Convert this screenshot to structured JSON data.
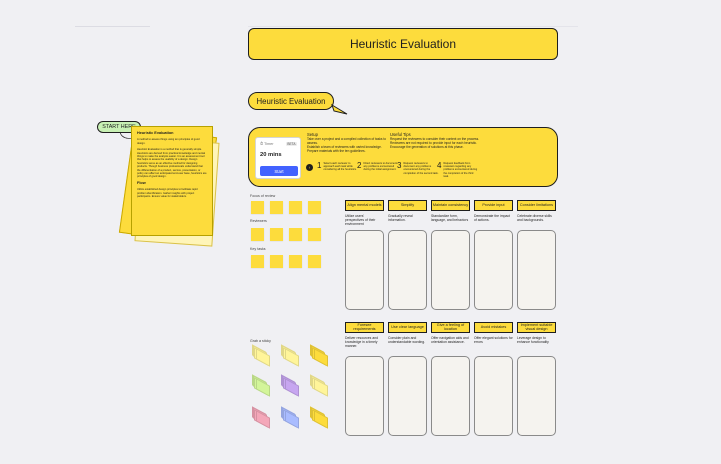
{
  "board": {
    "title": "Heuristic Evaluation",
    "bubble_title": "Heuristic Evaluation",
    "start_here": "START HERE"
  },
  "intro_note": {
    "heading": "Heuristic Evaluation",
    "p1": "A method to assess things using ten principles of good design.",
    "p2": "Heuristic Evaluation is a method that is generally simple. Heuristics are derived from practical knowledge and mental things to make the analysis easier. It is an assessment tool that helps to assess the usability of a design. Design heuristics serve as an effective method for designing products. Though business professionals understand that the differentiation of a product, service, presentation, or policy can affect an anticipated end-user base, heuristics are principles of good design.",
    "subheading": "Flow",
    "p3": "Utilize established design principles to facilitate rapid problem identification. Gather insights with project participants. Ensure value for stakeholders."
  },
  "setup": {
    "heading": "Setup",
    "line1": "Take over a project and a compiled collection of tasks to assess.",
    "line2": "Establish a team of reviewers with varied knowledge.",
    "line3": "Prepare materials with the ten guidelines.",
    "tips_heading": "Useful Tips",
    "tip1": "Request the reviewers to consider their context on the process.",
    "tip2": "Reviewers are not required to provide input for each heuristic.",
    "tip3": "Encourage the generation of solutions at this phase."
  },
  "timer": {
    "label": "Timer",
    "badge": "BETA",
    "value": "20 mins",
    "button": "Start"
  },
  "steps": [
    {
      "n": "1",
      "text": "Select each reviewer to approach each task while considering all the heuristics."
    },
    {
      "n": "2",
      "text": "Direct reviewers to document any problems encountered during the initial assignment."
    },
    {
      "n": "3",
      "text": "Request reviewers to document any problems encountered during the completion of the second task."
    },
    {
      "n": "4",
      "text": "Request feedback from reviewers regarding any problems encountered during the completion of the third task."
    }
  ],
  "sticky_groups": [
    {
      "label": "Focus of review",
      "count": 4
    },
    {
      "label": "Reviewers",
      "count": 4
    },
    {
      "label": "Key tasks",
      "count": 4
    }
  ],
  "grab_label": "Grab a sticky",
  "heuristics_row1": [
    {
      "label": "Align mental models",
      "desc": "Utilize users' perspectives of their environment"
    },
    {
      "label": "Simplify",
      "desc": "Gradually reveal information."
    },
    {
      "label": "Maintain consistency",
      "desc": "Standardize form, language, and behaviors"
    },
    {
      "label": "Provide input",
      "desc": "Demonstrate the impact of actions."
    },
    {
      "label": "Consider limitations",
      "desc": "Celebrate diverse skills and backgrounds."
    }
  ],
  "heuristics_row2": [
    {
      "label": "Foresee requirements",
      "desc": "Deliver resources and knowledge in a timely manner."
    },
    {
      "label": "Use clear language",
      "desc": "Consider plain and understandable wording."
    },
    {
      "label": "Give a feeling of location",
      "desc": "Offer navigation aids and orientation assistance."
    },
    {
      "label": "Avoid mistakes",
      "desc": "Offer elegant solutions for errors"
    },
    {
      "label": "Implement suitable visual design",
      "desc": "Leverage design to enhance functionality"
    }
  ],
  "colors": {
    "yellow": "#fddc3c",
    "light_yellow": "#fff59a",
    "green": "#d3f59a",
    "purple": "#c7a6f0",
    "pink": "#f4a7b9",
    "blue": "#a9bcff",
    "board_bg": "#f0f0f3"
  }
}
